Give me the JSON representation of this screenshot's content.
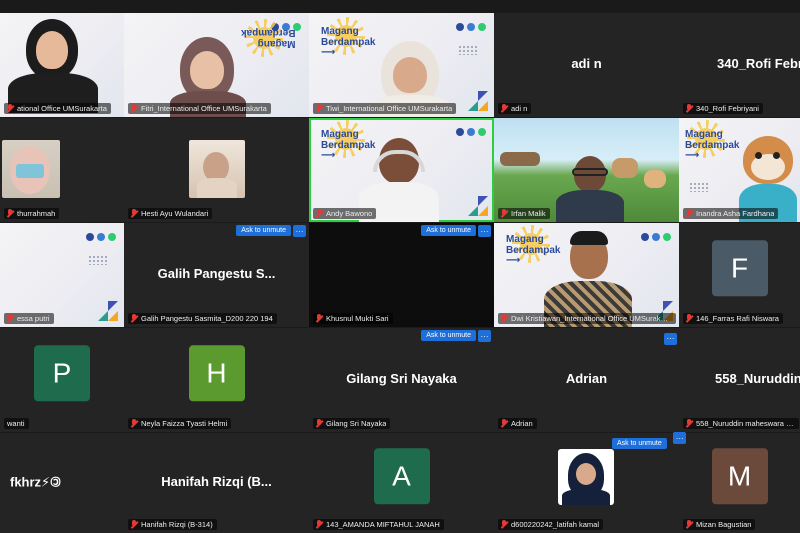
{
  "tiles": [
    {
      "name": "ational Office UMSurakarta",
      "kind": "video"
    },
    {
      "name": "Fitri_International Office UMSurakarta",
      "kind": "video"
    },
    {
      "name": "Tiwi_International Office UMSurakarta",
      "kind": "video"
    },
    {
      "name": "adi n",
      "kind": "text",
      "display": "adi n"
    },
    {
      "name": "340_Rofi Febriyani",
      "kind": "text",
      "display": "340_Rofi Febriy"
    },
    {
      "name": "thurrahmah",
      "kind": "video"
    },
    {
      "name": "Hesti Ayu Wulandari",
      "kind": "video"
    },
    {
      "name": "Andy Bawono",
      "kind": "video",
      "active": true
    },
    {
      "name": "Irfan Malik",
      "kind": "video"
    },
    {
      "name": "Inandra Asha Fardhana",
      "kind": "video"
    },
    {
      "name": "essa putri",
      "kind": "video"
    },
    {
      "name": "Galih Pangestu Sasmita_D200 220 194",
      "kind": "text",
      "display": "Galih Pangestu S..."
    },
    {
      "name": "Khusnul Mukti Sari",
      "kind": "black"
    },
    {
      "name": "Dwi Kristiawan_International Office UMSurakarta",
      "kind": "video"
    },
    {
      "name": "146_Farras Rafi Niswara",
      "kind": "avatar",
      "letter": "F",
      "color": "#4a5a66"
    },
    {
      "name": "wanti",
      "kind": "avatar",
      "letter": "P",
      "color": "#1e6b4e"
    },
    {
      "name": "Neyla Faizza Tyasti Helmi",
      "kind": "avatar",
      "letter": "H",
      "color": "#5a9a2e"
    },
    {
      "name": "Gilang Sri Nayaka",
      "kind": "text",
      "display": "Gilang Sri Nayaka"
    },
    {
      "name": "Adrian",
      "kind": "text",
      "display": "Adrian"
    },
    {
      "name": "558_Nuruddin maheswara harso",
      "kind": "text",
      "display": "558_Nuruddin"
    },
    {
      "name": "",
      "kind": "text",
      "display": "fkhrz⚡🄯"
    },
    {
      "name": "Hanifah Rizqi (B-314)",
      "kind": "text",
      "display": "Hanifah Rizqi (B..."
    },
    {
      "name": "143_AMANDA MIFTAHUL JANAH",
      "kind": "avatar",
      "letter": "A",
      "color": "#1e6b4e"
    },
    {
      "name": "d600220242_latifah kamal",
      "kind": "photo"
    },
    {
      "name": "Mizan Bagustian",
      "kind": "avatar",
      "letter": "M",
      "color": "#6b4a3c"
    }
  ],
  "unmute": {
    "label": "Ask to unmute",
    "more": "···"
  },
  "slide": {
    "brand_line1": "Magang",
    "brand_line2": "Berdampak",
    "brand_arrow": "⟶"
  },
  "colors": {
    "active_border": "#2ecc40",
    "unmute_bg": "#1e6fd9",
    "muted_icon": "#e53935"
  }
}
